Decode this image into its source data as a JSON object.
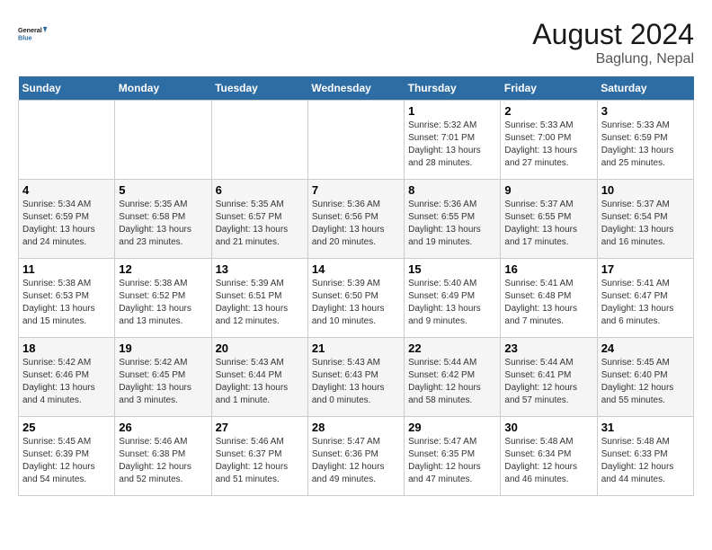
{
  "header": {
    "logo_general": "General",
    "logo_blue": "Blue",
    "month_year": "August 2024",
    "location": "Baglung, Nepal"
  },
  "days_of_week": [
    "Sunday",
    "Monday",
    "Tuesday",
    "Wednesday",
    "Thursday",
    "Friday",
    "Saturday"
  ],
  "weeks": [
    [
      {
        "day": "",
        "info": ""
      },
      {
        "day": "",
        "info": ""
      },
      {
        "day": "",
        "info": ""
      },
      {
        "day": "",
        "info": ""
      },
      {
        "day": "1",
        "info": "Sunrise: 5:32 AM\nSunset: 7:01 PM\nDaylight: 13 hours\nand 28 minutes."
      },
      {
        "day": "2",
        "info": "Sunrise: 5:33 AM\nSunset: 7:00 PM\nDaylight: 13 hours\nand 27 minutes."
      },
      {
        "day": "3",
        "info": "Sunrise: 5:33 AM\nSunset: 6:59 PM\nDaylight: 13 hours\nand 25 minutes."
      }
    ],
    [
      {
        "day": "4",
        "info": "Sunrise: 5:34 AM\nSunset: 6:59 PM\nDaylight: 13 hours\nand 24 minutes."
      },
      {
        "day": "5",
        "info": "Sunrise: 5:35 AM\nSunset: 6:58 PM\nDaylight: 13 hours\nand 23 minutes."
      },
      {
        "day": "6",
        "info": "Sunrise: 5:35 AM\nSunset: 6:57 PM\nDaylight: 13 hours\nand 21 minutes."
      },
      {
        "day": "7",
        "info": "Sunrise: 5:36 AM\nSunset: 6:56 PM\nDaylight: 13 hours\nand 20 minutes."
      },
      {
        "day": "8",
        "info": "Sunrise: 5:36 AM\nSunset: 6:55 PM\nDaylight: 13 hours\nand 19 minutes."
      },
      {
        "day": "9",
        "info": "Sunrise: 5:37 AM\nSunset: 6:55 PM\nDaylight: 13 hours\nand 17 minutes."
      },
      {
        "day": "10",
        "info": "Sunrise: 5:37 AM\nSunset: 6:54 PM\nDaylight: 13 hours\nand 16 minutes."
      }
    ],
    [
      {
        "day": "11",
        "info": "Sunrise: 5:38 AM\nSunset: 6:53 PM\nDaylight: 13 hours\nand 15 minutes."
      },
      {
        "day": "12",
        "info": "Sunrise: 5:38 AM\nSunset: 6:52 PM\nDaylight: 13 hours\nand 13 minutes."
      },
      {
        "day": "13",
        "info": "Sunrise: 5:39 AM\nSunset: 6:51 PM\nDaylight: 13 hours\nand 12 minutes."
      },
      {
        "day": "14",
        "info": "Sunrise: 5:39 AM\nSunset: 6:50 PM\nDaylight: 13 hours\nand 10 minutes."
      },
      {
        "day": "15",
        "info": "Sunrise: 5:40 AM\nSunset: 6:49 PM\nDaylight: 13 hours\nand 9 minutes."
      },
      {
        "day": "16",
        "info": "Sunrise: 5:41 AM\nSunset: 6:48 PM\nDaylight: 13 hours\nand 7 minutes."
      },
      {
        "day": "17",
        "info": "Sunrise: 5:41 AM\nSunset: 6:47 PM\nDaylight: 13 hours\nand 6 minutes."
      }
    ],
    [
      {
        "day": "18",
        "info": "Sunrise: 5:42 AM\nSunset: 6:46 PM\nDaylight: 13 hours\nand 4 minutes."
      },
      {
        "day": "19",
        "info": "Sunrise: 5:42 AM\nSunset: 6:45 PM\nDaylight: 13 hours\nand 3 minutes."
      },
      {
        "day": "20",
        "info": "Sunrise: 5:43 AM\nSunset: 6:44 PM\nDaylight: 13 hours\nand 1 minute."
      },
      {
        "day": "21",
        "info": "Sunrise: 5:43 AM\nSunset: 6:43 PM\nDaylight: 13 hours\nand 0 minutes."
      },
      {
        "day": "22",
        "info": "Sunrise: 5:44 AM\nSunset: 6:42 PM\nDaylight: 12 hours\nand 58 minutes."
      },
      {
        "day": "23",
        "info": "Sunrise: 5:44 AM\nSunset: 6:41 PM\nDaylight: 12 hours\nand 57 minutes."
      },
      {
        "day": "24",
        "info": "Sunrise: 5:45 AM\nSunset: 6:40 PM\nDaylight: 12 hours\nand 55 minutes."
      }
    ],
    [
      {
        "day": "25",
        "info": "Sunrise: 5:45 AM\nSunset: 6:39 PM\nDaylight: 12 hours\nand 54 minutes."
      },
      {
        "day": "26",
        "info": "Sunrise: 5:46 AM\nSunset: 6:38 PM\nDaylight: 12 hours\nand 52 minutes."
      },
      {
        "day": "27",
        "info": "Sunrise: 5:46 AM\nSunset: 6:37 PM\nDaylight: 12 hours\nand 51 minutes."
      },
      {
        "day": "28",
        "info": "Sunrise: 5:47 AM\nSunset: 6:36 PM\nDaylight: 12 hours\nand 49 minutes."
      },
      {
        "day": "29",
        "info": "Sunrise: 5:47 AM\nSunset: 6:35 PM\nDaylight: 12 hours\nand 47 minutes."
      },
      {
        "day": "30",
        "info": "Sunrise: 5:48 AM\nSunset: 6:34 PM\nDaylight: 12 hours\nand 46 minutes."
      },
      {
        "day": "31",
        "info": "Sunrise: 5:48 AM\nSunset: 6:33 PM\nDaylight: 12 hours\nand 44 minutes."
      }
    ]
  ]
}
